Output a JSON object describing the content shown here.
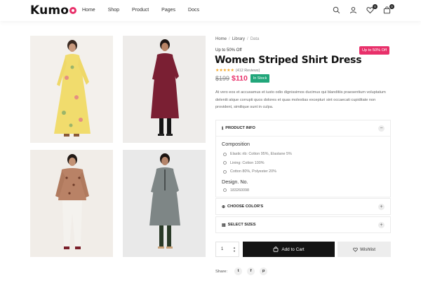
{
  "brand": {
    "logo": "Kumo",
    "accent": "#e8306a"
  },
  "nav": {
    "items": [
      "Home",
      "Shop",
      "Product",
      "Pages",
      "Docs"
    ]
  },
  "header_icons": {
    "search": "search-icon",
    "account": "user-icon",
    "wishlist": {
      "icon": "heart-icon",
      "count": "0"
    },
    "cart": {
      "icon": "bag-icon",
      "count": "0"
    }
  },
  "breadcrumb": {
    "home": "Home",
    "section": "Library",
    "current": "Data"
  },
  "product": {
    "promo_text": "Up to 50% Off",
    "promo_badge": "Up to 50% Off",
    "title": "Women Striped Shirt Dress",
    "stars": "★★★★★",
    "rating": 4,
    "reviews": "(412 Reviews)",
    "old_price": "$199",
    "price": "$110",
    "stock": "In Stock",
    "description": "At vero eos et accusamus et iusto odio dignissimos ducimus qui blanditiis praesentium voluptatum deleniti atque corrupti quos dolores et quas molestias excepturi sint occaecati cupiditate non provident, similique sunt in culpa."
  },
  "accordion": {
    "info": {
      "title": "PRODUCT INFO",
      "toggle": "−",
      "composition_label": "Composition",
      "composition": [
        "Elastic rib: Cotton 95%, Elastane 5%",
        "Lining: Cotton 100%",
        "Cotton 80%, Polyester 20%"
      ],
      "design_label": "Design. No.",
      "design_no": "183260098"
    },
    "colors": {
      "title": "CHOOSE COLOR'S",
      "toggle": "+"
    },
    "sizes": {
      "title": "SELECT SIZES",
      "toggle": "+"
    }
  },
  "purchase": {
    "quantity": "1",
    "add_to_cart": "Add to Cart",
    "wishlist": "Wishlist"
  },
  "share": {
    "label": "Share:",
    "networks": [
      "t",
      "f",
      "p"
    ]
  }
}
